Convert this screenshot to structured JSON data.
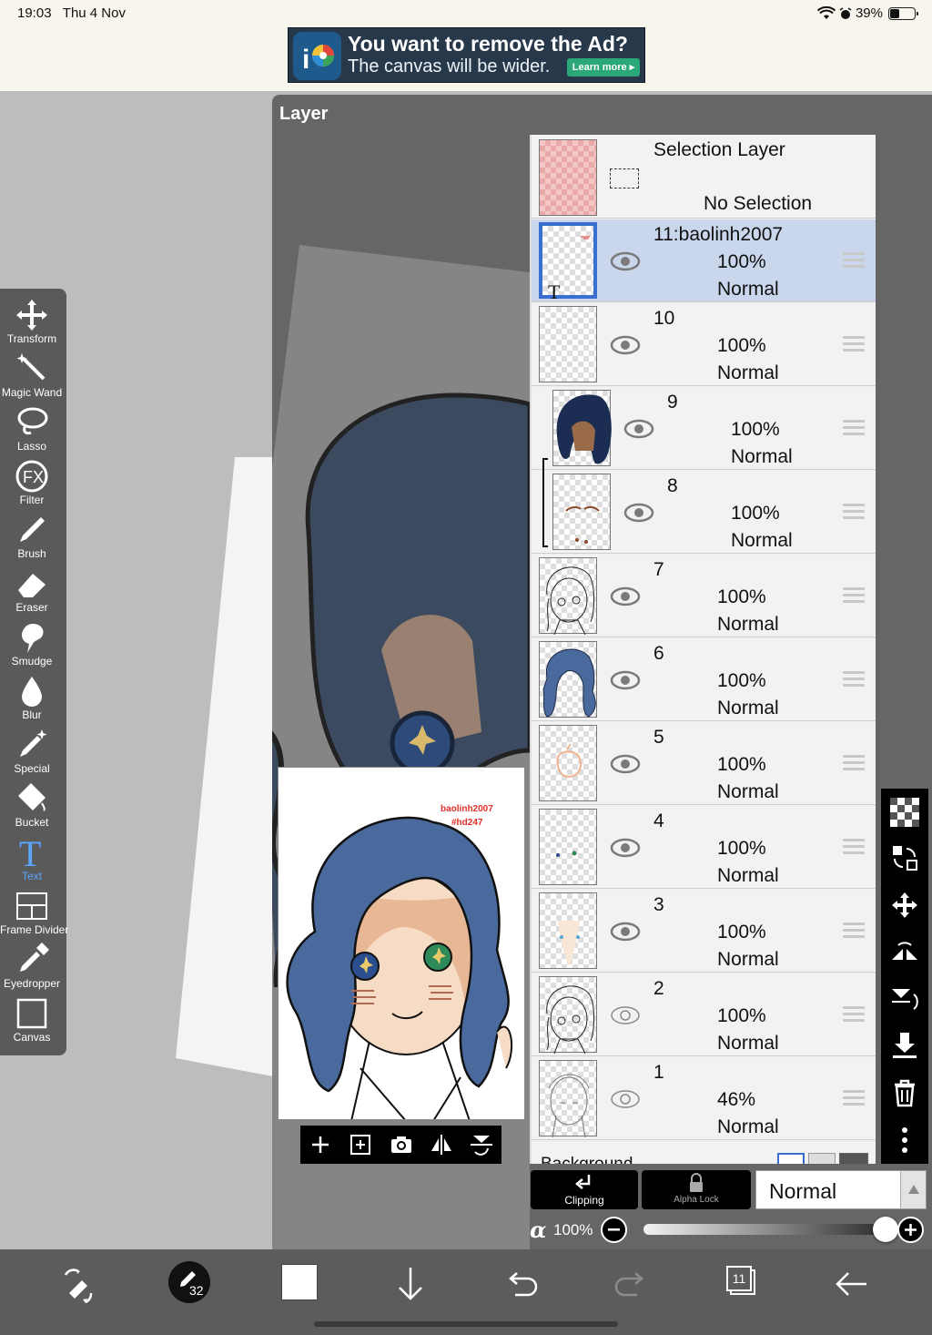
{
  "status_bar": {
    "time": "19:03",
    "date": "Thu 4 Nov",
    "battery": "39%",
    "battery_level": 0.39
  },
  "ad": {
    "title": "You want to remove the Ad?",
    "subtitle": "The canvas will be wider.",
    "button": "Learn more ▸"
  },
  "panel": {
    "title": "Layer"
  },
  "tools": [
    {
      "id": "transform",
      "label": "Transform",
      "icon": "move-arrows-icon"
    },
    {
      "id": "magic-wand",
      "label": "Magic Wand",
      "icon": "magic-wand-icon"
    },
    {
      "id": "lasso",
      "label": "Lasso",
      "icon": "lasso-icon"
    },
    {
      "id": "filter",
      "label": "Filter",
      "icon": "fx-icon"
    },
    {
      "id": "brush",
      "label": "Brush",
      "icon": "brush-icon"
    },
    {
      "id": "eraser",
      "label": "Eraser",
      "icon": "eraser-icon"
    },
    {
      "id": "smudge",
      "label": "Smudge",
      "icon": "smudge-icon"
    },
    {
      "id": "blur",
      "label": "Blur",
      "icon": "drop-icon"
    },
    {
      "id": "special",
      "label": "Special",
      "icon": "sparkle-pen-icon"
    },
    {
      "id": "bucket",
      "label": "Bucket",
      "icon": "bucket-icon"
    },
    {
      "id": "text",
      "label": "Text",
      "icon": "text-t-icon",
      "active": true
    },
    {
      "id": "frame-divider",
      "label": "Frame Divider",
      "icon": "frame-divider-icon"
    },
    {
      "id": "eyedropper",
      "label": "Eyedropper",
      "icon": "eyedropper-icon"
    },
    {
      "id": "canvas",
      "label": "Canvas",
      "icon": "canvas-square-icon"
    }
  ],
  "selection_layer": {
    "name": "Selection Layer",
    "status": "No Selection"
  },
  "layers": [
    {
      "name": "11:baolinh2007",
      "opacity": "100%",
      "mode": "Normal",
      "visible": true,
      "selected": true,
      "thumb": "text"
    },
    {
      "name": "10",
      "opacity": "100%",
      "mode": "Normal",
      "visible": true,
      "thumb": "empty"
    },
    {
      "name": "9",
      "opacity": "100%",
      "mode": "Normal",
      "visible": true,
      "thumb": "hair-dark",
      "clip_base": true
    },
    {
      "name": "8",
      "opacity": "100%",
      "mode": "Normal",
      "visible": true,
      "thumb": "brows",
      "clipped": true
    },
    {
      "name": "7",
      "opacity": "100%",
      "mode": "Normal",
      "visible": true,
      "thumb": "lineart"
    },
    {
      "name": "6",
      "opacity": "100%",
      "mode": "Normal",
      "visible": true,
      "thumb": "hair-blue"
    },
    {
      "name": "5",
      "opacity": "100%",
      "mode": "Normal",
      "visible": true,
      "thumb": "skin-outline"
    },
    {
      "name": "4",
      "opacity": "100%",
      "mode": "Normal",
      "visible": true,
      "thumb": "eyes-dots"
    },
    {
      "name": "3",
      "opacity": "100%",
      "mode": "Normal",
      "visible": true,
      "thumb": "face-light"
    },
    {
      "name": "2",
      "opacity": "100%",
      "mode": "Normal",
      "visible": false,
      "thumb": "lineart"
    },
    {
      "name": "1",
      "opacity": "46%",
      "mode": "Normal",
      "visible": false,
      "thumb": "sketch"
    }
  ],
  "background_label": "Background",
  "buttons": {
    "clipping": "Clipping",
    "alpha_lock": "Alpha Lock",
    "blend_mode": "Normal"
  },
  "opacity": {
    "symbol": "α",
    "value": "100%",
    "level": 1.0
  },
  "preview": {
    "text1": "baolinh2007",
    "text2": "#hd247"
  },
  "bottom_bar": {
    "brush_size": "32",
    "layer_count": "11"
  },
  "colors": {
    "accent": "#3a6fd0",
    "hair": "#4a6a9e",
    "selected_row": "#c9d6ec",
    "text_tool": "#5aa6ff"
  }
}
